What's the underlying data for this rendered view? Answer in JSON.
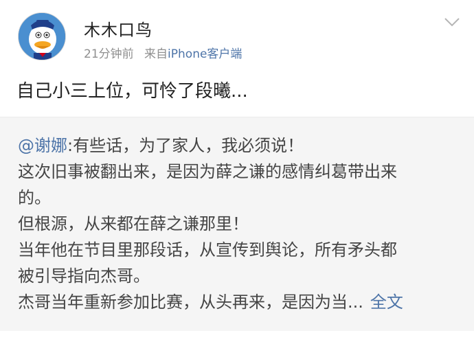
{
  "post": {
    "username": "木木口鸟",
    "time": "21分钟前",
    "source_prefix": "来自",
    "source": "iPhone客户端",
    "text": "自己小三上位，可怜了段曦..."
  },
  "repost": {
    "mention": "@谢娜",
    "lines": [
      ":有些话，为了家人，我必须说！",
      "这次旧事被翻出来，是因为薛之谦的感情纠葛带出来",
      "的。",
      "但根源，从来都在薛之谦那里！",
      "当年他在节目里那段话，从宣传到舆论，所有矛头都",
      "被引导指向杰哥。",
      "杰哥当年重新参加比赛，从头再来，是因为当..."
    ],
    "full_text_link": "全文"
  },
  "icons": {
    "avatar": "donald-duck-avatar",
    "menu": "chevron-down-icon"
  },
  "colors": {
    "link": "#4d74a8",
    "repost_bg": "#f5f5f5",
    "meta": "#8f8f8f"
  }
}
